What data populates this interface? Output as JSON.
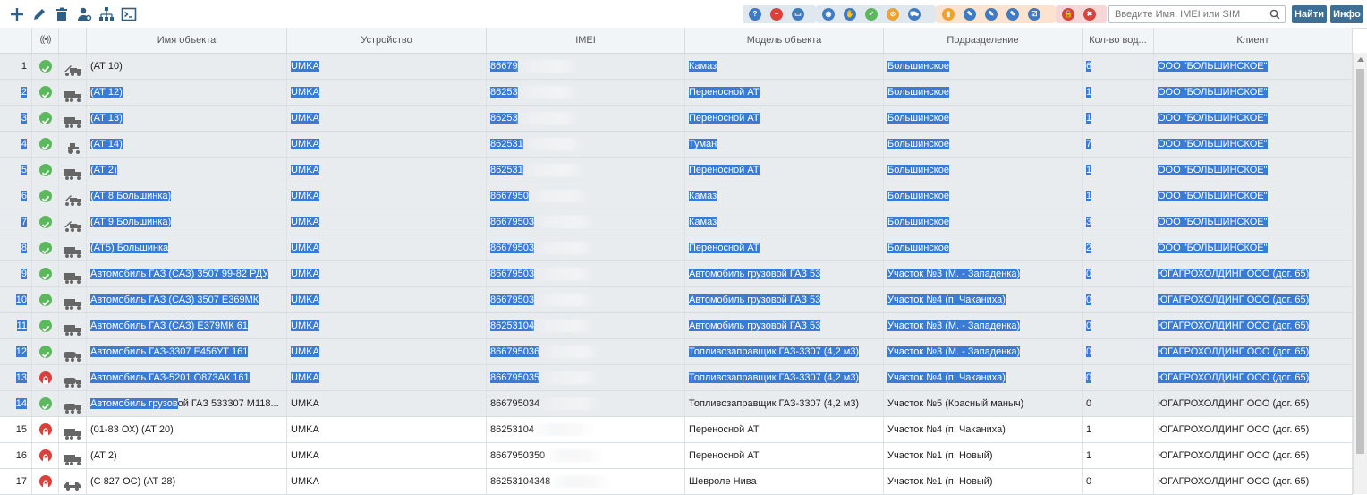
{
  "toolbar": {
    "left_icons": [
      "plus-icon",
      "pencil-icon",
      "trash-icon",
      "user-settings-icon",
      "hierarchy-icon",
      "terminal-icon"
    ],
    "groups": [
      {
        "bg": "#dfe7ef",
        "icons": [
          {
            "name": "help-icon",
            "color": "#3f7bc4",
            "glyph": "?"
          },
          {
            "name": "minus-icon",
            "color": "#d9413a",
            "glyph": "−"
          },
          {
            "name": "keyboard-icon",
            "color": "#3f7bc4",
            "glyph": "▭"
          }
        ]
      },
      {
        "bg": "#dfe7ef",
        "icons": [
          {
            "name": "eye-icon",
            "color": "#3f7bc4",
            "glyph": "◉"
          },
          {
            "name": "hand-icon",
            "color": "#3f7bc4",
            "glyph": "✋"
          },
          {
            "name": "check-icon",
            "color": "#5cb85c",
            "glyph": "✓"
          },
          {
            "name": "cancel-icon",
            "color": "#f0a22e",
            "glyph": "⊘"
          },
          {
            "name": "cart-icon",
            "color": "#3f7bc4",
            "glyph": "⛟"
          }
        ]
      },
      {
        "bg": "#fbe3cf",
        "icons": [
          {
            "name": "bar-chart-icon",
            "color": "#f0a22e",
            "glyph": "▮"
          },
          {
            "name": "wrench-icon",
            "color": "#3f7bc4",
            "glyph": "✎"
          },
          {
            "name": "wrench-alt-icon",
            "color": "#3f7bc4",
            "glyph": "✎"
          },
          {
            "name": "tools-icon",
            "color": "#3f7bc4",
            "glyph": "✎"
          },
          {
            "name": "checklist-icon",
            "color": "#3f7bc4",
            "glyph": "☑"
          }
        ]
      },
      {
        "bg": "#f6d6d6",
        "icons": [
          {
            "name": "lock-icon",
            "color": "#d9413a",
            "glyph": "🔒"
          },
          {
            "name": "delete-icon",
            "color": "#d9413a",
            "glyph": "✖"
          }
        ]
      }
    ],
    "search_placeholder": "Введите Имя, IMEI или SIM",
    "find_label": "Найти",
    "info_label": "Инфо"
  },
  "table": {
    "headers": [
      "",
      "((•))",
      "",
      "Имя объекта",
      "Устройство",
      "IMEI",
      "Модель объекта",
      "Подразделение",
      "Кол-во вод...",
      "Клиент"
    ],
    "rows": [
      {
        "num": "1",
        "status": "ok",
        "vehicle": "crane-truck-icon",
        "name": "(АТ 10)",
        "device": "UMKA",
        "imei": "86679",
        "model": "Камаз",
        "dept": "Большинское",
        "drivers": "6",
        "client": "ООО \"БОЛЬШИНСКОЕ\"",
        "hl": true,
        "num_hl": false,
        "name_hl": false
      },
      {
        "num": "2",
        "status": "ok",
        "vehicle": "truck-icon",
        "name": "(АТ 12)",
        "device": "UMKA",
        "imei": "86253",
        "model": "Переносной АТ",
        "dept": "Большинское",
        "drivers": "1",
        "client": "ООО \"БОЛЬШИНСКОЕ\"",
        "hl": true,
        "num_hl": true,
        "name_hl": true
      },
      {
        "num": "3",
        "status": "ok",
        "vehicle": "truck-icon",
        "name": "(АТ 13)",
        "device": "UMKA",
        "imei": "86253",
        "model": "Переносной АТ",
        "dept": "Большинское",
        "drivers": "1",
        "client": "ООО \"БОЛЬШИНСКОЕ\"",
        "hl": true,
        "num_hl": true,
        "name_hl": true
      },
      {
        "num": "4",
        "status": "ok",
        "vehicle": "tractor-icon",
        "name": "(АТ 14)",
        "device": "UMKA",
        "imei": "862531",
        "model": "Туман",
        "dept": "Большинское",
        "drivers": "7",
        "client": "ООО \"БОЛЬШИНСКОЕ\"",
        "hl": true,
        "num_hl": true,
        "name_hl": true
      },
      {
        "num": "5",
        "status": "ok",
        "vehicle": "truck-icon",
        "name": "(АТ 2)",
        "device": "UMKA",
        "imei": "862531",
        "model": "Переносной АТ",
        "dept": "Большинское",
        "drivers": "1",
        "client": "ООО \"БОЛЬШИНСКОЕ\"",
        "hl": true,
        "num_hl": true,
        "name_hl": true
      },
      {
        "num": "6",
        "status": "ok",
        "vehicle": "crane-truck-icon",
        "name": "(АТ 8 Большинка)",
        "device": "UMKA",
        "imei": "8667950",
        "model": "Камаз",
        "dept": "Большинское",
        "drivers": "1",
        "client": "ООО \"БОЛЬШИНСКОЕ\"",
        "hl": true,
        "num_hl": true,
        "name_hl": true
      },
      {
        "num": "7",
        "status": "ok",
        "vehicle": "crane-truck-icon",
        "name": "(АТ 9 Большинка)",
        "device": "UMKA",
        "imei": "86679503",
        "model": "Камаз",
        "dept": "Большинское",
        "drivers": "3",
        "client": "ООО \"БОЛЬШИНСКОЕ\"",
        "hl": true,
        "num_hl": true,
        "name_hl": true
      },
      {
        "num": "8",
        "status": "ok",
        "vehicle": "truck-icon",
        "name": "(АТ5) Большинка",
        "device": "UMKA",
        "imei": "86679503",
        "model": "Переносной АТ",
        "dept": "Большинское",
        "drivers": "2",
        "client": "ООО \"БОЛЬШИНСКОЕ\"",
        "hl": true,
        "num_hl": true,
        "name_hl": true
      },
      {
        "num": "9",
        "status": "ok",
        "vehicle": "truck-icon",
        "name": "Автомобиль ГАЗ (САЗ) 3507 99-82 РДУ",
        "device": "UMKA",
        "imei": "86679503",
        "model": "Автомобиль грузовой ГАЗ 53",
        "dept": "Участок №3 (М. - Западенка)",
        "drivers": "0",
        "client": "ЮГАГРОХОЛДИНГ ООО (дог. 65)",
        "hl": true,
        "num_hl": true,
        "name_hl": true
      },
      {
        "num": "10",
        "status": "ok",
        "vehicle": "truck-icon",
        "name": "Автомобиль ГАЗ (САЗ) 3507 Е369МК",
        "device": "UMKA",
        "imei": "86679503",
        "model": "Автомобиль грузовой ГАЗ 53",
        "dept": "Участок №4 (п. Чаканиха)",
        "drivers": "0",
        "client": "ЮГАГРОХОЛДИНГ ООО (дог. 65)",
        "hl": true,
        "num_hl": true,
        "name_hl": true
      },
      {
        "num": "11",
        "status": "ok",
        "vehicle": "truck-icon",
        "name": "Автомобиль ГАЗ (САЗ) Е379МК 61",
        "device": "UMKA",
        "imei": "86253104",
        "model": "Автомобиль грузовой ГАЗ 53",
        "dept": "Участок №3 (М. - Западенка)",
        "drivers": "0",
        "client": "ЮГАГРОХОЛДИНГ ООО (дог. 65)",
        "hl": true,
        "num_hl": true,
        "name_hl": true
      },
      {
        "num": "12",
        "status": "ok",
        "vehicle": "tanker-icon",
        "name": "Автомобиль ГАЗ-3307 Е456УТ 161",
        "device": "UMKA",
        "imei": "866795036",
        "model": "Топливозаправщик ГАЗ-3307 (4,2 м3)",
        "dept": "Участок №3 (М. - Западенка)",
        "drivers": "0",
        "client": "ЮГАГРОХОЛДИНГ ООО (дог. 65)",
        "hl": true,
        "num_hl": true,
        "name_hl": true
      },
      {
        "num": "13",
        "status": "locked",
        "vehicle": "tanker-icon",
        "name": "Автомобиль ГАЗ-5201 О873АК 161",
        "device": "UMKA",
        "imei": "866795035",
        "model": "Топливозаправщик ГАЗ-3307 (4,2 м3)",
        "dept": "Участок №4 (п. Чаканиха)",
        "drivers": "0",
        "client": "ЮГАГРОХОЛДИНГ ООО (дог. 65)",
        "hl": true,
        "num_hl": true,
        "name_hl": true
      },
      {
        "num": "14",
        "status": "ok",
        "vehicle": "tanker-icon",
        "name_part1": "Автомобиль грузов",
        "name_part2": "ой ГАЗ 533307 М118...",
        "device": "UMKA",
        "imei": "866795034",
        "model": "Топливозаправщик ГАЗ-3307 (4,2 м3)",
        "dept": "Участок №5 (Красный маныч)",
        "drivers": "0",
        "client": "ЮГАГРОХОЛДИНГ ООО (дог. 65)",
        "hl": false,
        "num_hl": true,
        "name_hl": false,
        "partial": true
      },
      {
        "num": "15",
        "status": "locked",
        "vehicle": "truck-icon",
        "name": "(01-83 ОХ) (АТ 20)",
        "device": "UMKA",
        "imei": "86253104",
        "model": "Переносной АТ",
        "dept": "Участок №4 (п. Чаканиха)",
        "drivers": "1",
        "client": "ЮГАГРОХОЛДИНГ ООО (дог. 65)",
        "hl": false,
        "num_hl": false,
        "name_hl": false,
        "plain": true
      },
      {
        "num": "16",
        "status": "locked",
        "vehicle": "truck-icon",
        "name": "(АТ 2)",
        "device": "UMKA",
        "imei": "8667950350",
        "model": "Переносной АТ",
        "dept": "Участок №1 (п. Новый)",
        "drivers": "1",
        "client": "ЮГАГРОХОЛДИНГ ООО (дог. 65)",
        "hl": false,
        "num_hl": false,
        "name_hl": false,
        "plain": true
      },
      {
        "num": "17",
        "status": "locked",
        "vehicle": "car-icon",
        "name": "(С 827 ОС) (АТ 28)",
        "device": "UMKA",
        "imei": "86253104348",
        "model": "Шевроле Нива",
        "dept": "Участок №1 (п. Новый)",
        "drivers": "0",
        "client": "ЮГАГРОХОЛДИНГ ООО (дог. 65)",
        "hl": false,
        "num_hl": false,
        "name_hl": false,
        "plain": true
      }
    ]
  }
}
